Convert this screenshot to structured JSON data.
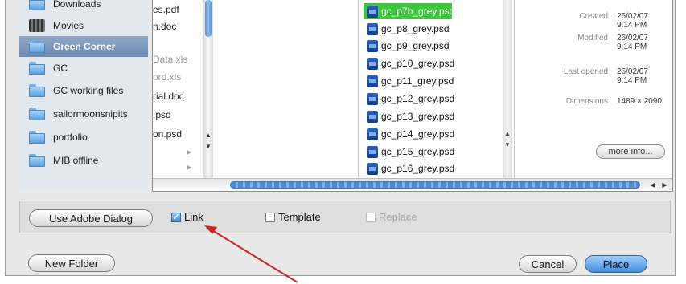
{
  "sidebar": {
    "items": [
      {
        "label": "Downloads",
        "icon": "folder-icon"
      },
      {
        "label": "Movies",
        "icon": "film-icon"
      },
      {
        "label": "Green Corner",
        "icon": "folder-icon",
        "selected": true
      },
      {
        "label": "GC",
        "icon": "folder-icon"
      },
      {
        "label": "GC working files",
        "icon": "folder-icon"
      },
      {
        "label": "sailormoonsnipits",
        "icon": "folder-icon"
      },
      {
        "label": "portfolio",
        "icon": "folder-icon"
      },
      {
        "label": "MIB offline",
        "icon": "folder-icon"
      }
    ]
  },
  "column1": {
    "items": [
      {
        "label": "es.pdf",
        "dim": false
      },
      {
        "label": "n.doc",
        "dim": false
      },
      {
        "label": "Data.xls",
        "dim": true
      },
      {
        "label": "ord.xls",
        "dim": true
      },
      {
        "label": "rial.doc",
        "dim": false
      },
      {
        "label": ".psd",
        "dim": false
      },
      {
        "label": "on.psd",
        "dim": false
      }
    ]
  },
  "files": {
    "items": [
      {
        "label": "gc_p7b_grey.psd",
        "selected": true
      },
      {
        "label": "gc_p8_grey.psd"
      },
      {
        "label": "gc_p9_grey.psd"
      },
      {
        "label": "gc_p10_grey.psd"
      },
      {
        "label": "gc_p11_grey.psd"
      },
      {
        "label": "gc_p12_grey.psd"
      },
      {
        "label": "gc_p13_grey.psd"
      },
      {
        "label": "gc_p14_grey.psd"
      },
      {
        "label": "gc_p15_grey.psd"
      },
      {
        "label": "gc_p16_grey.psd"
      }
    ]
  },
  "preview": {
    "created_label": "Created",
    "created_value": "26/02/07 9:14 PM",
    "modified_label": "Modified",
    "modified_value": "26/02/07 9:14 PM",
    "opened_label": "Last opened",
    "opened_value": "26/02/07 9:14 PM",
    "dimensions_label": "Dimensions",
    "dimensions_value": "1489 × 2090",
    "more_info_label": "more info..."
  },
  "options": {
    "adobe_dialog_label": "Use Adobe Dialog",
    "link_label": "Link",
    "link_checked": true,
    "template_label": "Template",
    "replace_label": "Replace"
  },
  "footer": {
    "new_folder_label": "New Folder",
    "cancel_label": "Cancel",
    "place_label": "Place"
  },
  "annotation": {
    "arrow_color": "#d0241d"
  },
  "colors": {
    "selection_green": "#3bc93b",
    "accent_blue": "#3f8ee4"
  }
}
